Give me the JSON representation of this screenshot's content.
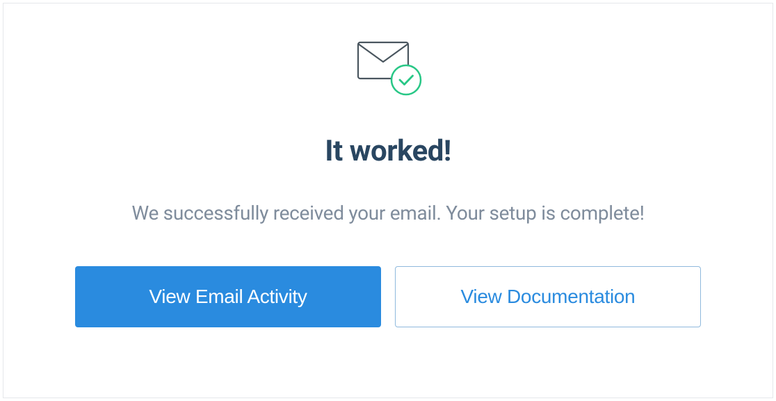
{
  "heading": "It worked!",
  "subtext": "We successfully received your email. Your setup is complete!",
  "buttons": {
    "primary": "View Email Activity",
    "secondary": "View Documentation"
  }
}
